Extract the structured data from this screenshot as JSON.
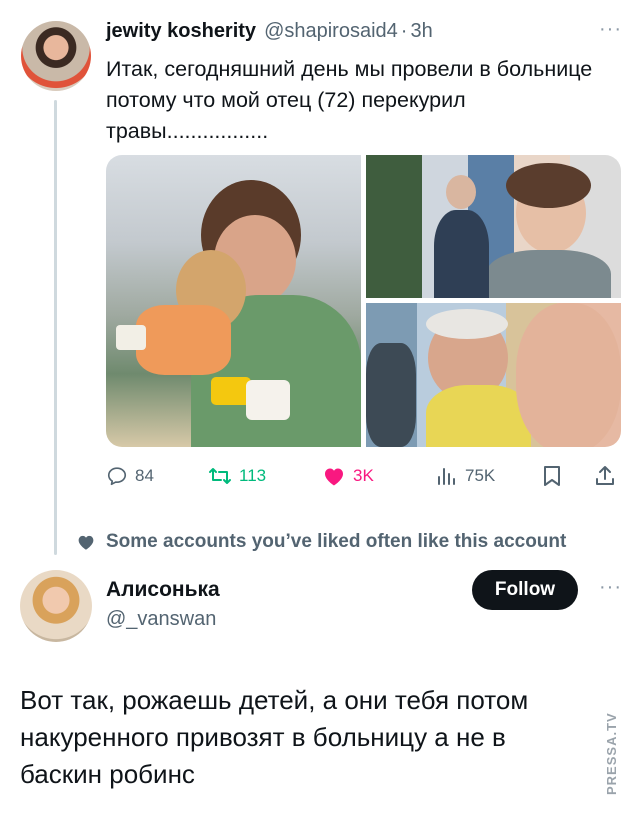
{
  "tweet1": {
    "author_name": "jewity kosherity",
    "handle": "@shapirosaid4",
    "dot": "·",
    "time": "3h",
    "more": "···",
    "text": "Итак, сегодняшний день мы провели в больнице потому что мой отец (72) перекурил травы.................",
    "media_count": 3,
    "actions": {
      "replies": "84",
      "retweets": "113",
      "likes": "3K",
      "views": "75K"
    }
  },
  "social_context": "Some accounts you’ve liked often like this account",
  "tweet2": {
    "author_name": "Алисонька",
    "handle": "@_vanswan",
    "follow_label": "Follow",
    "more": "···",
    "text": "Вот так, рожаешь детей, а они тебя потом накуренного привозят в больницу а не в баскин робинс"
  },
  "watermark": "PRESSA.TV",
  "colors": {
    "text": "#0f1419",
    "muted": "#536471",
    "retweet": "#00ba7c",
    "like": "#f91880",
    "follow_bg": "#0f1419"
  },
  "icons": [
    "reply-icon",
    "retweet-icon",
    "heart-icon",
    "views-icon",
    "bookmark-icon",
    "share-icon",
    "heart-small-icon",
    "more-icon"
  ]
}
